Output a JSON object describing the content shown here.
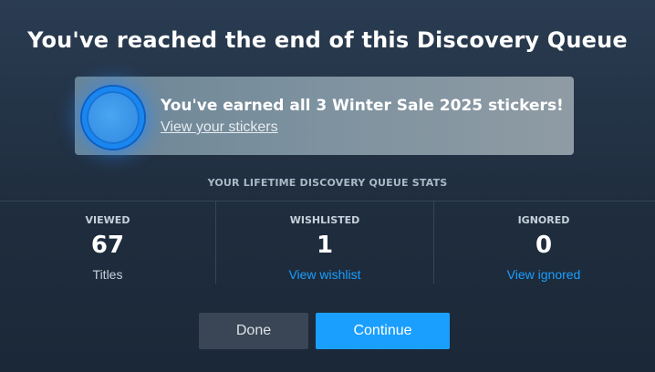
{
  "title": "You've reached the end of this Discovery Queue",
  "reward_banner": {
    "badge_icon": "winter-sale-sticker-badge-icon",
    "message": "You've earned all 3 Winter Sale 2025 stickers!",
    "link_label": "View your stickers"
  },
  "stats": {
    "header": "YOUR LIFETIME DISCOVERY QUEUE STATS",
    "columns": [
      {
        "label": "VIEWED",
        "value": "67",
        "sub": "Titles"
      },
      {
        "label": "WISHLISTED",
        "value": "1",
        "sub": "View wishlist"
      },
      {
        "label": "IGNORED",
        "value": "0",
        "sub": "View ignored"
      }
    ]
  },
  "buttons": {
    "done": "Done",
    "continue": "Continue"
  },
  "colors": {
    "accent": "#1a9fff",
    "background": "#1b2838",
    "done_button": "#3a4656"
  }
}
